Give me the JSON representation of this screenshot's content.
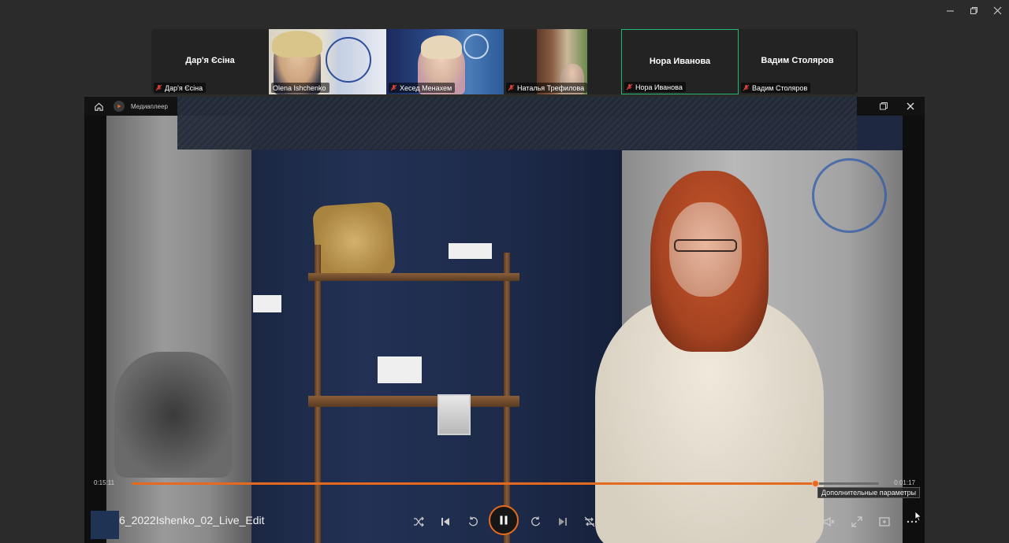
{
  "window": {
    "controls": {
      "minimize": "—",
      "restore": "❐",
      "close": "✕"
    }
  },
  "participants": [
    {
      "name": "Дар'я Єсіна",
      "label": "Дар'я Єсіна",
      "video": false,
      "muted": true
    },
    {
      "name": "Olena Ishchenko",
      "label": "Olena Ishchenko",
      "video": true,
      "muted": false
    },
    {
      "name": "Хесед Менахем",
      "label": "Хесед Менахем",
      "video": true,
      "muted": true
    },
    {
      "name": "Наталья Трефилова",
      "label": "Наталья Трефилова",
      "video": true,
      "muted": true
    },
    {
      "name": "Нора Иванова",
      "label": "Нора Иванова",
      "video": false,
      "muted": true,
      "active_speaker": true
    },
    {
      "name": "Вадим Столяров",
      "label": "Вадим Столяров",
      "video": false,
      "muted": true
    }
  ],
  "share": {
    "app_title": "Медиаплеер"
  },
  "player": {
    "elapsed": "0:15:11",
    "remaining": "0:01:17",
    "progress": 0.915,
    "file_title": "6_2022Ishenko_02_Live_Edit",
    "tooltip": "Дополнительные параметры",
    "state": "playing"
  },
  "colors": {
    "accent": "#e56a1f",
    "active_speaker_border": "#25b874",
    "mute_icon": "#e0443a"
  }
}
